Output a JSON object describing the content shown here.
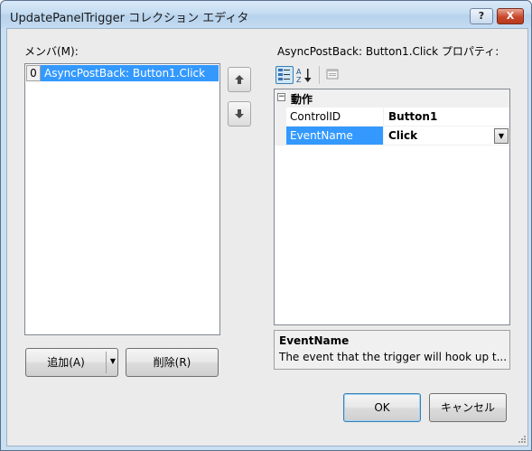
{
  "window": {
    "title": "UpdatePanelTrigger コレクション エディタ",
    "help_button": "?",
    "close_button": "X"
  },
  "members": {
    "label": "メンバ(M):",
    "items": [
      {
        "index": "0",
        "text": "AsyncPostBack: Button1.Click"
      }
    ],
    "move_up_icon": "arrow-up-icon",
    "move_down_icon": "arrow-down-icon",
    "add_button": "追加(A)",
    "remove_button": "削除(R)"
  },
  "properties": {
    "label": "AsyncPostBack: Button1.Click プロパティ:",
    "toolbar": {
      "categorized_icon": "categorized-icon",
      "alphabetical_icon": "alphabetical-icon",
      "property_pages_icon": "property-pages-icon"
    },
    "category": {
      "toggle": "−",
      "name": "動作"
    },
    "rows": [
      {
        "name": "ControlID",
        "value": "Button1"
      },
      {
        "name": "EventName",
        "value": "Click"
      }
    ],
    "description": {
      "title": "EventName",
      "text": "The event that the trigger will hook up t..."
    }
  },
  "footer": {
    "ok_button": "OK",
    "cancel_button": "キャンセル"
  },
  "colors": {
    "selection": "#3399ff",
    "window_frame": "#c9dff2",
    "dialog_bg": "#ebebeb"
  }
}
